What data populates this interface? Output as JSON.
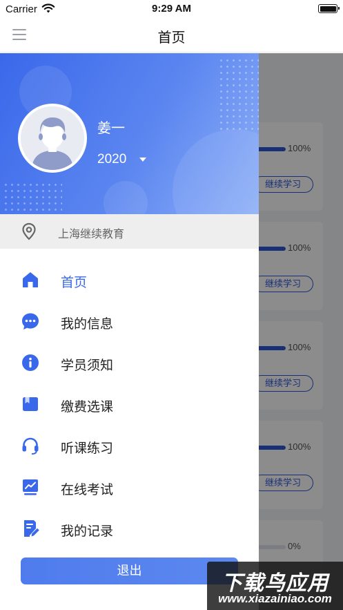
{
  "status_bar": {
    "carrier": "Carrier",
    "time": "9:29 AM"
  },
  "nav": {
    "title": "首页"
  },
  "background_cards": [
    {
      "progress": 100,
      "percent_label": "100%",
      "button_label": "继续学习"
    },
    {
      "progress": 100,
      "percent_label": "100%",
      "button_label": "继续学习"
    },
    {
      "progress": 100,
      "percent_label": "100%",
      "button_label": "继续学习"
    },
    {
      "progress": 100,
      "percent_label": "100%",
      "button_label": "继续学习"
    },
    {
      "progress": 0,
      "percent_label": "0%",
      "button_label": ""
    }
  ],
  "drawer": {
    "user_name": "姜一",
    "year": "2020",
    "location": "上海继续教育",
    "menu": [
      {
        "label": "首页",
        "icon": "home-icon",
        "active": true
      },
      {
        "label": "我的信息",
        "icon": "chat-bubble-icon",
        "active": false
      },
      {
        "label": "学员须知",
        "icon": "info-icon",
        "active": false
      },
      {
        "label": "缴费选课",
        "icon": "book-icon",
        "active": false
      },
      {
        "label": "听课练习",
        "icon": "headset-icon",
        "active": false
      },
      {
        "label": "在线考试",
        "icon": "chart-icon",
        "active": false
      },
      {
        "label": "我的记录",
        "icon": "note-edit-icon",
        "active": false
      }
    ],
    "logout_label": "退出"
  },
  "watermark": {
    "line1": "下载鸟应用",
    "line2": "www.xiazainiao.com"
  },
  "colors": {
    "accent": "#3a68ea",
    "header_gradient_start": "#3a68ea",
    "header_gradient_end": "#8fb0f7"
  }
}
